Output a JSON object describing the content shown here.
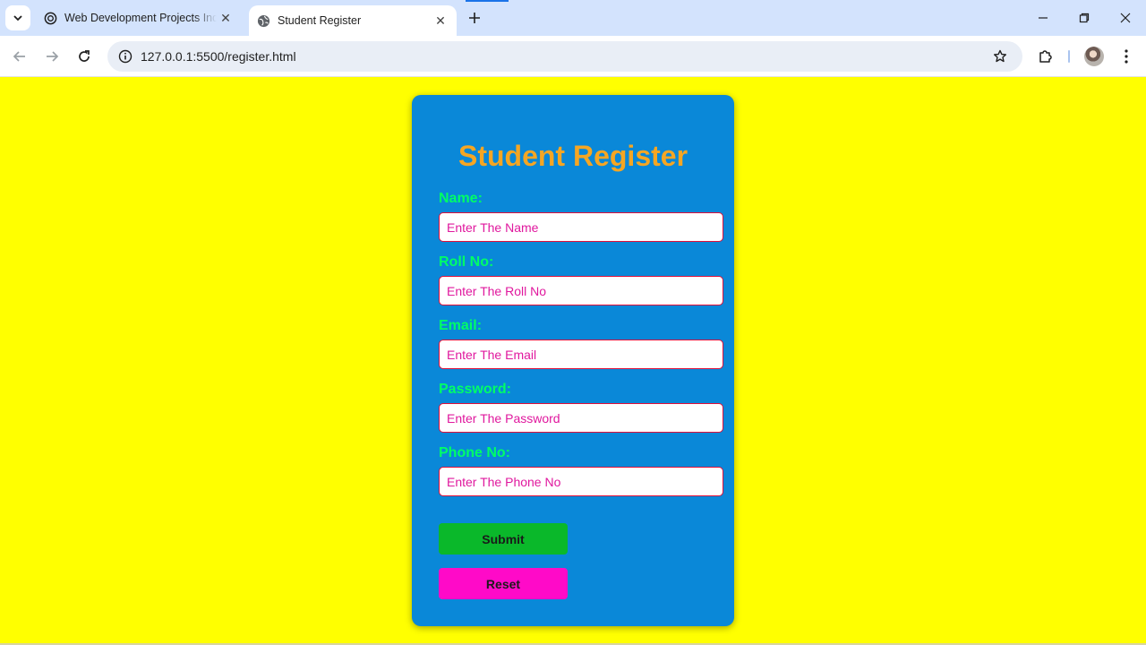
{
  "browser": {
    "tabs": [
      {
        "title": "Web Development Projects Inqu",
        "active": false,
        "icon": "chatgpt-icon"
      },
      {
        "title": "Student Register",
        "active": true,
        "icon": "globe-icon"
      }
    ],
    "url": "127.0.0.1:5500/register.html"
  },
  "page": {
    "background_color": "#ffff00",
    "card_color": "#0a88d8",
    "title": "Student Register",
    "fields": [
      {
        "label": "Name:",
        "placeholder": "Enter The Name"
      },
      {
        "label": "Roll No:",
        "placeholder": "Enter The Roll No"
      },
      {
        "label": "Email:",
        "placeholder": "Enter The Email"
      },
      {
        "label": "Password:",
        "placeholder": "Enter The Password"
      },
      {
        "label": "Phone No:",
        "placeholder": "Enter The Phone No"
      }
    ],
    "submit_label": "Submit",
    "reset_label": "Reset",
    "colors": {
      "title": "#f5a623",
      "labels": "#00ff66",
      "placeholder": "#e0189e",
      "submit": "#0ab82a",
      "reset": "#ff0ac8"
    }
  }
}
